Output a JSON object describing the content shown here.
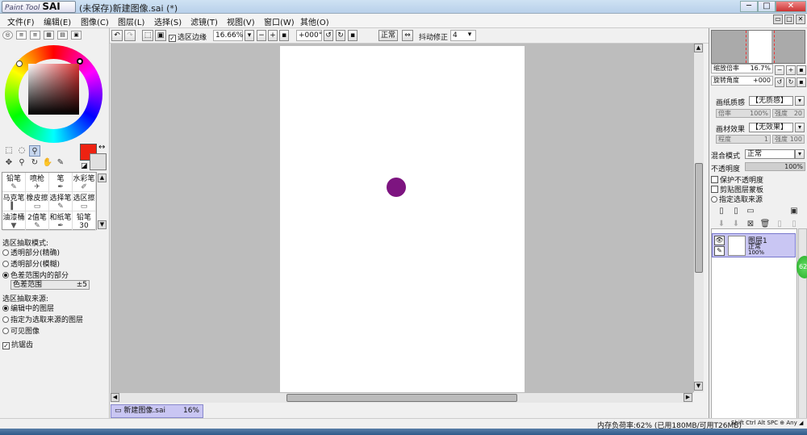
{
  "titlebar": {
    "logo_small": "Paint Tool",
    "logo_big": "SAI",
    "title": "(未保存)新建图像.sai (*)",
    "min": "─",
    "max": "□",
    "close": "✕"
  },
  "menubar": {
    "items": [
      "文件(F)",
      "编辑(E)",
      "图像(C)",
      "图层(L)",
      "选择(S)",
      "滤镜(T)",
      "视图(V)",
      "窗口(W)",
      "其他(O)"
    ]
  },
  "toolbar": {
    "select_edge": "选区边缘",
    "zoom": "16.66%",
    "rotation": "+000°",
    "blend": "正常",
    "stabilizer_label": "抖动修正",
    "stabilizer": "4"
  },
  "brushes": [
    {
      "name": "铅笔",
      "icon": "✎"
    },
    {
      "name": "喷枪",
      "icon": "✈"
    },
    {
      "name": "笔",
      "icon": "✒"
    },
    {
      "name": "水彩笔",
      "icon": "✐"
    },
    {
      "name": "马克笔",
      "icon": "▍"
    },
    {
      "name": "橡皮擦",
      "icon": "▭"
    },
    {
      "name": "选择笔",
      "icon": "✎"
    },
    {
      "name": "选区擦",
      "icon": "▭"
    },
    {
      "name": "油漆桶",
      "icon": "▼"
    },
    {
      "name": "2值笔",
      "icon": "✎"
    },
    {
      "name": "和纸笔",
      "icon": "✒"
    },
    {
      "name": "铅笔30",
      "icon": "✎"
    }
  ],
  "selection_options": {
    "mode_title": "选区抽取模式:",
    "modes": [
      "透明部分(精确)",
      "透明部分(模糊)",
      "色差范围内的部分"
    ],
    "range_label": "色差范围",
    "range_value": "±5",
    "source_title": "选区抽取来源:",
    "sources": [
      "编辑中的图层",
      "指定为选取来源的图层",
      "可见图像"
    ],
    "antialias": "抗锯齿"
  },
  "canvas": {
    "dot_color": "#7d1480",
    "paper_color": "#ffffff"
  },
  "doc_tab": {
    "name": "新建图像.sai",
    "zoom": "16%"
  },
  "status": {
    "memory": "内存负荷率:62% (已用180MB/可用T26MB)",
    "keys": "Shift Ctrl Alt SPC ⊕ Any ◢"
  },
  "right": {
    "zoom_label": "缩放倍率",
    "zoom_value": "16.7%",
    "angle_label": "旋转角度",
    "angle_value": "+000",
    "paper_texture_label": "画纸质感",
    "paper_texture_value": "【无质感】",
    "rate_label": "倍率",
    "rate_value": "100%",
    "strength_label": "强度",
    "strength_value": "20",
    "effect_label": "画材效果",
    "effect_value": "【无效果】",
    "degree_label": "程度",
    "degree_value": "1",
    "strength2_value": "100",
    "blend_label": "混合模式",
    "blend_value": "正常",
    "opacity_label": "不透明度",
    "opacity_value": "100%",
    "protect_opacity": "保护不透明度",
    "clip_mask": "剪贴图层蒙板",
    "select_source": "指定选取来源"
  },
  "layer": {
    "name": "图层1",
    "mode": "正常",
    "opacity": "100%"
  },
  "colors": {
    "main": "#ee2211",
    "sub": "#e0e0e0",
    "layer_highlight": "#c9c6f3"
  }
}
